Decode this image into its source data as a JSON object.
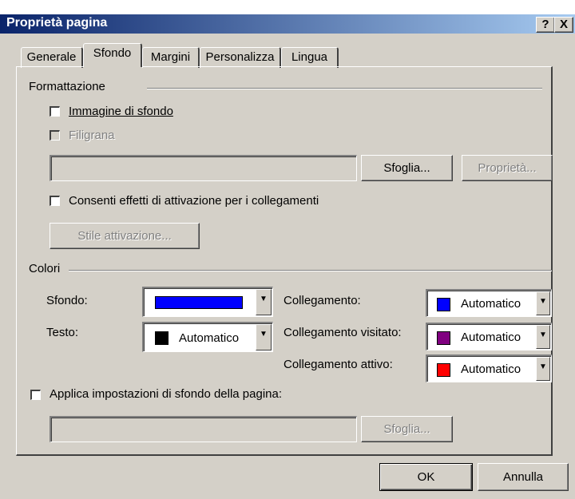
{
  "window": {
    "title": "Proprietà pagina",
    "help_button": "?",
    "close_button": "X"
  },
  "tabs": [
    {
      "label": "Generale",
      "active": false
    },
    {
      "label": "Sfondo",
      "active": true
    },
    {
      "label": "Margini",
      "active": false
    },
    {
      "label": "Personalizza",
      "active": false
    },
    {
      "label": "Lingua",
      "active": false
    }
  ],
  "formatting": {
    "group_label": "Formattazione",
    "background_image": {
      "label": "Immagine di sfondo",
      "checked": false
    },
    "watermark": {
      "label": "Filigrana",
      "checked": false,
      "enabled": false
    },
    "image_path": {
      "value": ""
    },
    "browse_button": "Sfoglia...",
    "properties_button": "Proprietà...",
    "rollover_effects": {
      "label": "Consenti effetti di attivazione per i collegamenti",
      "checked": false
    },
    "rollover_style_button": "Stile attivazione..."
  },
  "colors": {
    "group_label": "Colori",
    "background": {
      "label": "Sfondo:",
      "value": "",
      "color": "#0000ff"
    },
    "text": {
      "label": "Testo:",
      "value": "Automatico",
      "color": "#000000"
    },
    "hyperlink": {
      "label": "Collegamento:",
      "value": "Automatico",
      "color": "#0000ff"
    },
    "visited_hyperlink": {
      "label": "Collegamento visitato:",
      "value": "Automatico",
      "color": "#800080"
    },
    "active_hyperlink": {
      "label": "Collegamento attivo:",
      "value": "Automatico",
      "color": "#ff0000"
    }
  },
  "apply_background": {
    "label": "Applica impostazioni di sfondo della pagina:",
    "checked": false,
    "path": "",
    "browse_button": "Sfoglia..."
  },
  "footer": {
    "ok_button": "OK",
    "cancel_button": "Annulla"
  }
}
